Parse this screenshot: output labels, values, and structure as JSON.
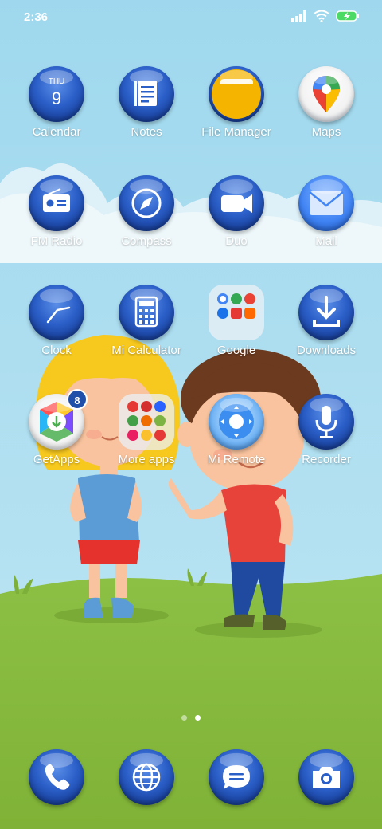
{
  "status_bar": {
    "time": "2:36"
  },
  "calendar_icon": {
    "weekday": "THU",
    "day": "9"
  },
  "apps": {
    "calendar": "Calendar",
    "notes": "Notes",
    "file_manager": "File Manager",
    "maps": "Maps",
    "fm_radio": "FM Radio",
    "compass": "Compass",
    "duo": "Duo",
    "mail": "Mail",
    "clock": "Clock",
    "mi_calculator": "Mi Calculator",
    "google": "Google",
    "downloads": "Downloads",
    "getapps": "GetApps",
    "more_apps": "More apps",
    "mi_remote": "Mi Remote",
    "recorder": "Recorder"
  },
  "badges": {
    "getapps": "8"
  },
  "dock": [
    "phone",
    "browser",
    "messages",
    "camera"
  ],
  "page_indicator": {
    "pages": 2,
    "active": 2
  },
  "colors": {
    "sky": "#a8dcef",
    "grass": "#8fc146",
    "icon_blue": "#2b5fc8"
  }
}
